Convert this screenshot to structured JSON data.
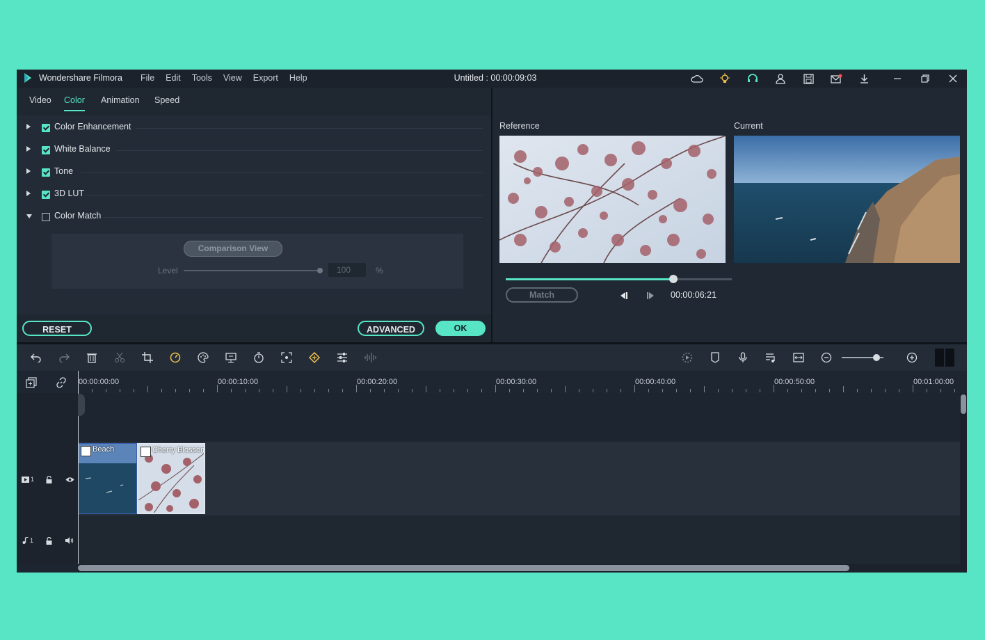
{
  "app": {
    "name": "Wondershare Filmora",
    "title": "Untitled : 00:00:09:03"
  },
  "menu": [
    "File",
    "Edit",
    "Tools",
    "View",
    "Export",
    "Help"
  ],
  "tabs": [
    {
      "label": "Video",
      "active": false
    },
    {
      "label": "Color",
      "active": true
    },
    {
      "label": "Animation",
      "active": false
    },
    {
      "label": "Speed",
      "active": false
    }
  ],
  "sections": [
    {
      "label": "Color Enhancement",
      "checked": true,
      "expanded": false
    },
    {
      "label": "White Balance",
      "checked": true,
      "expanded": false
    },
    {
      "label": "Tone",
      "checked": true,
      "expanded": false
    },
    {
      "label": "3D LUT",
      "checked": true,
      "expanded": false
    },
    {
      "label": "Color Match",
      "checked": false,
      "expanded": true
    }
  ],
  "color_match": {
    "comparison_view": "Comparison View",
    "level_label": "Level",
    "level_value": "100",
    "unit": "%",
    "level_fraction": 1.0
  },
  "buttons": {
    "reset": "RESET",
    "advanced": "ADVANCED",
    "ok": "OK"
  },
  "preview": {
    "reference_label": "Reference",
    "current_label": "Current",
    "match_label": "Match",
    "time": "00:00:06:21",
    "progress_fraction": 0.74
  },
  "timeline": {
    "ticks": [
      "00:00:00:00",
      "00:00:10:00",
      "00:00:20:00",
      "00:00:30:00",
      "00:00:40:00",
      "00:00:50:00",
      "00:01:00:00"
    ],
    "video_track": "1",
    "audio_track": "1",
    "clips": [
      {
        "name": "Beach"
      },
      {
        "name": "Cherry Blossom"
      }
    ]
  },
  "colors": {
    "accent": "#57e5c6",
    "background": "#1d2530"
  }
}
